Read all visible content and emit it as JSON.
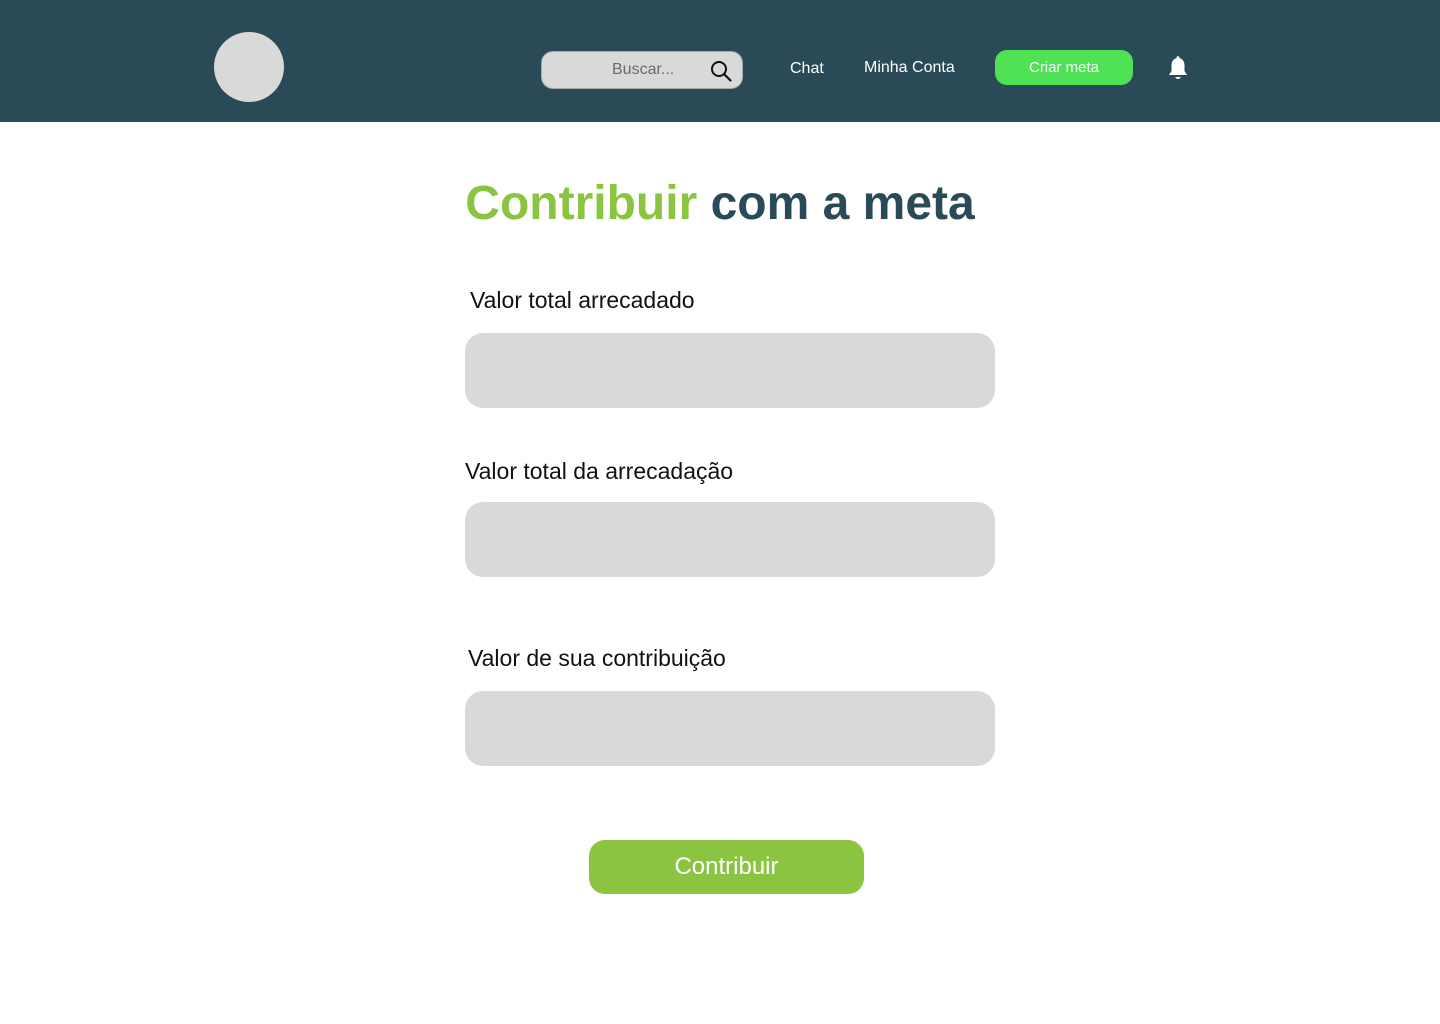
{
  "header": {
    "search": {
      "placeholder": "Buscar...",
      "value": "",
      "icon": "search-icon"
    },
    "nav": {
      "chat_label": "Chat",
      "account_label": "Minha Conta"
    },
    "create_button_label": "Criar meta",
    "notification_icon": "bell-icon"
  },
  "main": {
    "title_accent": "Contribuir",
    "title_rest": "com a meta",
    "fields": [
      {
        "label": "Valor total arrecadado",
        "value": ""
      },
      {
        "label": "Valor total da arrecadação",
        "value": ""
      },
      {
        "label": "Valor de sua contribuição",
        "value": ""
      }
    ],
    "submit_label": "Contribuir"
  },
  "colors": {
    "header_bg": "#2b4a57",
    "accent_green": "#8bc441",
    "create_button": "#4fe254",
    "input_bg": "#d9d9d9"
  }
}
